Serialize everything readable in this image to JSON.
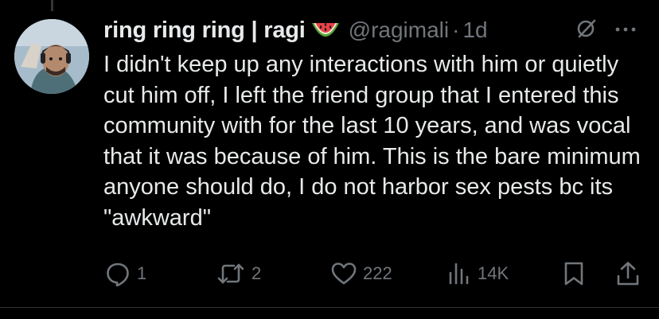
{
  "tweet": {
    "display_name": "ring ring ring | ragi",
    "name_emoji": "watermelon-emoji",
    "handle": "@ragimali",
    "separator": "·",
    "time": "1d",
    "text": "I didn't keep up any interactions with him or quietly cut him off, I left the friend group that I entered this community with for the last 10 years, and was vocal that it was because of him. This is the bare minimum anyone should do, I do not harbor sex pests bc its \"awkward\"",
    "header_icons": [
      "grok-icon",
      "more-icon"
    ],
    "actions": {
      "replies": "1",
      "reposts": "2",
      "likes": "222",
      "views": "14K"
    }
  },
  "colors": {
    "background": "#000000",
    "text_primary": "#e7e9ea",
    "text_secondary": "#71767b",
    "divider": "#2f3336"
  }
}
